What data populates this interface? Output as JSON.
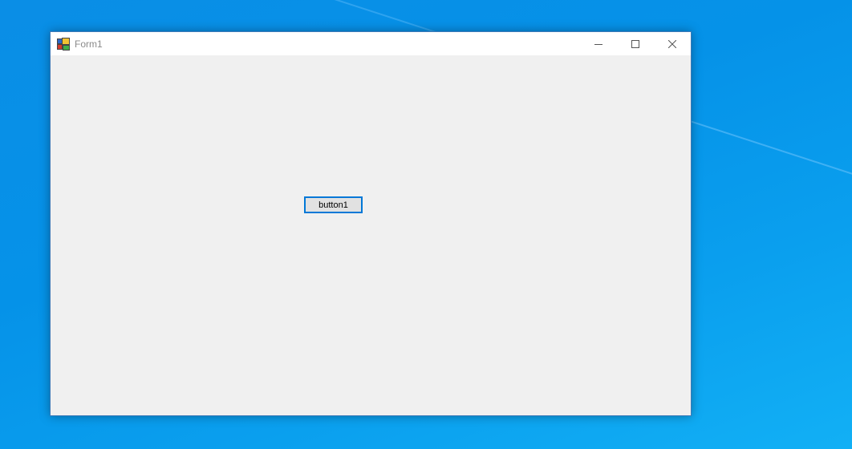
{
  "window": {
    "title": "Form1",
    "icon": "winforms-app-icon",
    "caption_buttons": [
      "minimize-icon",
      "maximize-icon",
      "close-icon"
    ]
  },
  "form": {
    "button1_label": "button1"
  },
  "colors": {
    "desktop": "#0592e8",
    "titlebar": "#ffffff",
    "client": "#f0f0f0",
    "button_face": "#e1e1e1",
    "focus_border": "#0078d7"
  }
}
